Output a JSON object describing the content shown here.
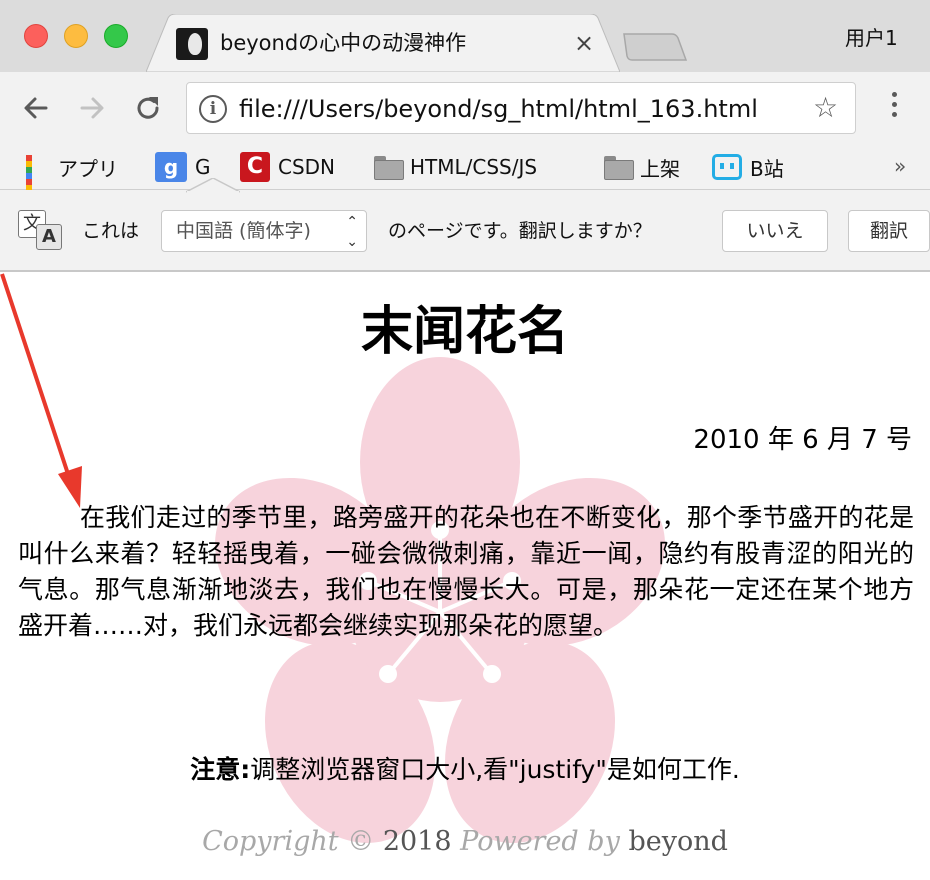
{
  "window": {
    "profile_name": "用户1"
  },
  "tab": {
    "title": "beyondの心中の动漫神作",
    "close_glyph": "×"
  },
  "toolbar": {
    "url": "file:///Users/beyond/sg_html/html_163.html",
    "info_glyph": "i",
    "star_glyph": "☆"
  },
  "bookmarks": {
    "items": [
      {
        "label": "アプリ",
        "icon": "apps-grid-icon"
      },
      {
        "label": "G",
        "icon": "google-translate-icon"
      },
      {
        "label": "CSDN",
        "icon": "csdn-icon"
      },
      {
        "label": "HTML/CSS/JS",
        "icon": "folder-icon"
      },
      {
        "label": "上架",
        "icon": "folder-icon"
      },
      {
        "label": "B站",
        "icon": "bilibili-icon"
      }
    ],
    "more_glyph": "»"
  },
  "translate_bar": {
    "prefix": "これは",
    "language": "中国語 (簡体字)",
    "suffix": "のページです。翻訳しますか？",
    "no_button": "いいえ",
    "translate_button": "翻訳",
    "icon_char_1": "文",
    "icon_char_2": "A"
  },
  "page": {
    "title": "末闻花名",
    "date": "2010 年 6 月 7 号",
    "paragraph": "在我们走过的季节里，路旁盛开的花朵也在不断变化，那个季节盛开的花是叫什么来着？轻轻摇曳着，一碰会微微刺痛，靠近一闻，隐约有股青涩的阳光的气息。那气息渐渐地淡去，我们也在慢慢长大。可是，那朵花一定还在某个地方盛开着……对，我们永远都会继续实现那朵花的愿望。",
    "note_label": "注意:",
    "note_text": "调整浏览器窗口大小,看\"justify\"是如何工作.",
    "footer": {
      "copyright": "Copyright",
      "symbol": "©",
      "year": "2018",
      "powered_by": "Powered by",
      "author": "beyond"
    }
  },
  "colors": {
    "accent_red": "#e8392c",
    "watermark_pink": "#f7d3dc",
    "csdn_red": "#c9171e",
    "bilibili_blue": "#23ade5"
  }
}
